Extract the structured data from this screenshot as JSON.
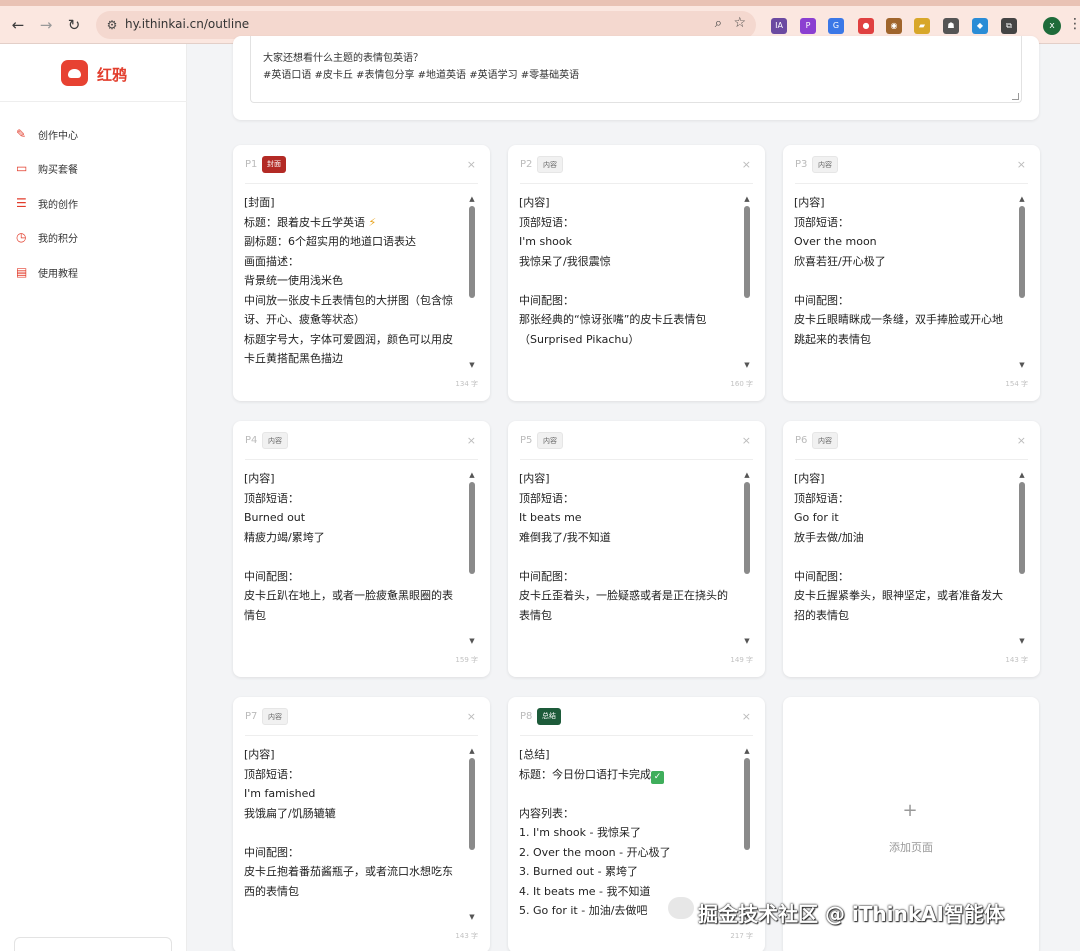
{
  "browser": {
    "url": "hy.ithinkai.cn/outline",
    "profile_initial": "x",
    "extensions": [
      {
        "name": "ia-extension-icon",
        "color": "#6b4aa1",
        "glyph": "IA"
      },
      {
        "name": "pocket-extension-icon",
        "color": "#8b3fd1",
        "glyph": "P"
      },
      {
        "name": "translate-extension-icon",
        "color": "#3b78e7",
        "glyph": "G"
      },
      {
        "name": "pokeball-extension-icon",
        "color": "#e04040",
        "glyph": "●"
      },
      {
        "name": "cookie-extension-icon",
        "color": "#a0652c",
        "glyph": "◉"
      },
      {
        "name": "folder-extension-icon",
        "color": "#d8a72a",
        "glyph": "▰"
      },
      {
        "name": "robot-extension-icon",
        "color": "#555555",
        "glyph": "☗"
      },
      {
        "name": "edge-extension-icon",
        "color": "#2a8cd6",
        "glyph": "◆"
      },
      {
        "name": "puzzle-extension-icon",
        "color": "#444444",
        "glyph": "⧉"
      }
    ]
  },
  "sidebar": {
    "brand_name": "红鸦",
    "items": [
      {
        "label": "创作中心",
        "icon": "pen-icon",
        "glyph": "✎"
      },
      {
        "label": "购买套餐",
        "icon": "card-icon",
        "glyph": "▭"
      },
      {
        "label": "我的创作",
        "icon": "list-icon",
        "glyph": "☰"
      },
      {
        "label": "我的积分",
        "icon": "clock-icon",
        "glyph": "◷"
      },
      {
        "label": "使用教程",
        "icon": "book-icon",
        "glyph": "▤"
      }
    ]
  },
  "description": {
    "line1": "大家还想看什么主题的表情包英语？",
    "line2": "#英语口语 #皮卡丘 #表情包分享 #地道英语 #英语学习 #零基础英语"
  },
  "pages": [
    {
      "num": "P1",
      "tag": "封面",
      "tag_type": "cover",
      "count": "134 字",
      "lines": [
        "[封面]",
        "标题：跟着皮卡丘学英语",
        "副标题：6个超实用的地道口语表达",
        "画面描述：",
        "背景统一使用浅米色",
        "中间放一张皮卡丘表情包的大拼图（包含惊",
        "讶、开心、疲惫等状态）",
        "标题字号大，字体可爱圆润，颜色可以用皮",
        "卡丘黄搭配黑色描边"
      ]
    },
    {
      "num": "P2",
      "tag": "内容",
      "tag_type": "content",
      "count": "160 字",
      "lines": [
        "[内容]",
        "顶部短语：",
        "I'm shook",
        "我惊呆了/我很震惊",
        "",
        "中间配图：",
        "那张经典的“惊讶张嘴”的皮卡丘表情包",
        "（Surprised Pikachu）"
      ]
    },
    {
      "num": "P3",
      "tag": "内容",
      "tag_type": "content",
      "count": "154 字",
      "lines": [
        "[内容]",
        "顶部短语：",
        "Over the moon",
        "欣喜若狂/开心极了",
        "",
        "中间配图：",
        "皮卡丘眼睛眯成一条缝，双手捧脸或开心地",
        "跳起来的表情包"
      ]
    },
    {
      "num": "P4",
      "tag": "内容",
      "tag_type": "content",
      "count": "159 字",
      "lines": [
        "[内容]",
        "顶部短语：",
        "Burned out",
        "精疲力竭/累垮了",
        "",
        "中间配图：",
        "皮卡丘趴在地上，或者一脸疲惫黑眼圈的表",
        "情包"
      ]
    },
    {
      "num": "P5",
      "tag": "内容",
      "tag_type": "content",
      "count": "149 字",
      "lines": [
        "[内容]",
        "顶部短语：",
        "It beats me",
        "难倒我了/我不知道",
        "",
        "中间配图：",
        "皮卡丘歪着头，一脸疑惑或者是正在挠头的",
        "表情包"
      ]
    },
    {
      "num": "P6",
      "tag": "内容",
      "tag_type": "content",
      "count": "143 字",
      "lines": [
        "[内容]",
        "顶部短语：",
        "Go for it",
        "放手去做/加油",
        "",
        "中间配图：",
        "皮卡丘握紧拳头，眼神坚定，或者准备发大",
        "招的表情包"
      ]
    },
    {
      "num": "P7",
      "tag": "内容",
      "tag_type": "content",
      "count": "143 字",
      "lines": [
        "[内容]",
        "顶部短语：",
        "I'm famished",
        "我饿扁了/饥肠辘辘",
        "",
        "中间配图：",
        "皮卡丘抱着番茄酱瓶子，或者流口水想吃东",
        "西的表情包"
      ]
    },
    {
      "num": "P8",
      "tag": "总结",
      "tag_type": "summary",
      "count": "217 字",
      "lines": [
        "[总结]",
        "标题：今日份口语打卡完成",
        "",
        "内容列表：",
        "1. I'm shook - 我惊呆了",
        "2. Over the moon - 开心极了",
        "3. Burned out - 累垮了",
        "4. It beats me - 我不知道",
        "5. Go for it - 加油/去做吧"
      ]
    }
  ],
  "add_page_label": "添加页面",
  "watermark_text": "掘金技术社区 @ iThinkAI智能体"
}
